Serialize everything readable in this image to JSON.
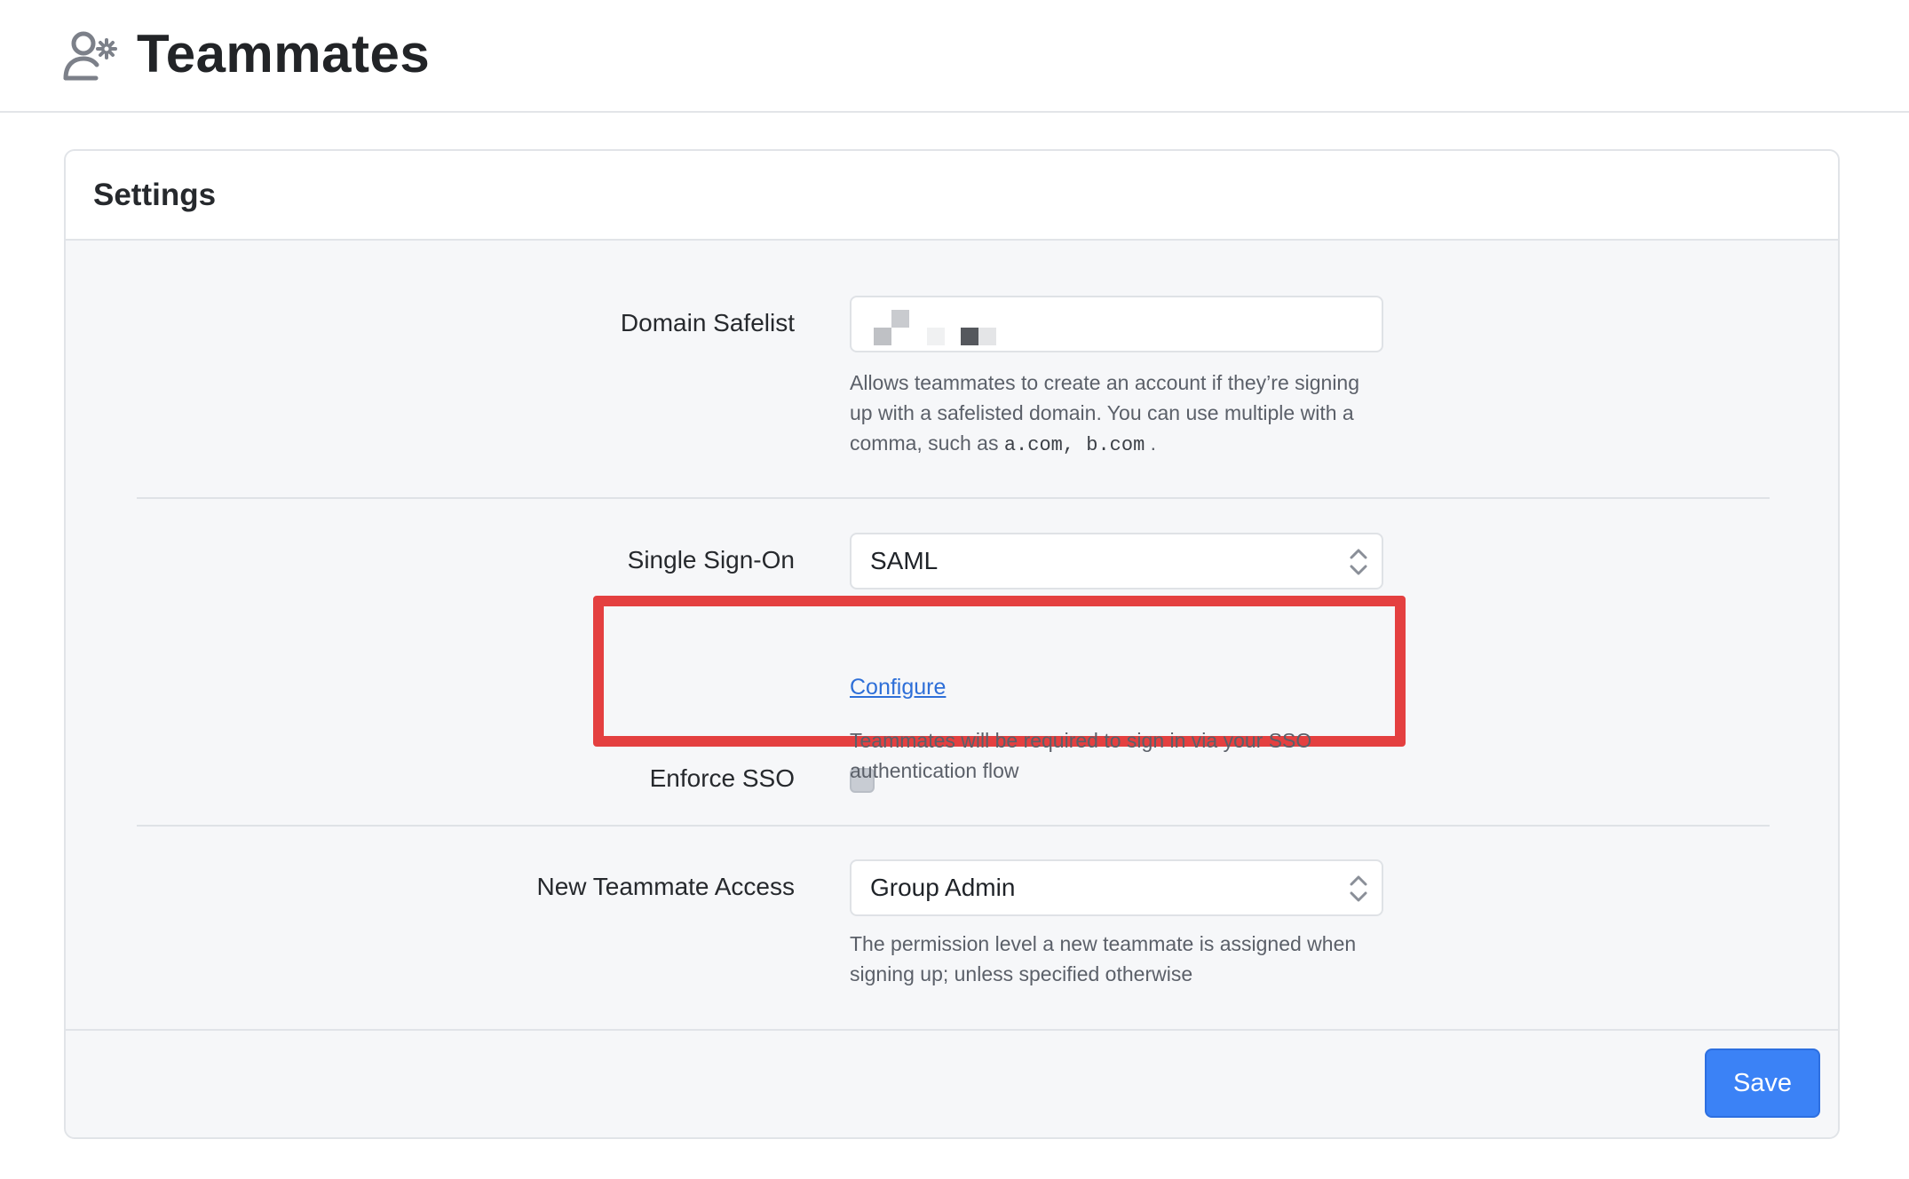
{
  "header": {
    "title": "Teammates",
    "icon": "user-gear-icon"
  },
  "settings": {
    "title": "Settings",
    "domain_safelist": {
      "label": "Domain Safelist",
      "help_prefix": "Allows teammates to create an account if they’re signing up with a safelisted domain. You can use multiple with a comma, such as ",
      "help_code": "a.com, b.com",
      "help_suffix": " ."
    },
    "single_sign_on": {
      "label": "Single Sign-On",
      "selected": "SAML",
      "configure_link": "Configure"
    },
    "enforce_sso": {
      "label": "Enforce SSO",
      "checked": false,
      "help": "Teammates will be required to sign in via your SSO authentication flow"
    },
    "new_teammate_access": {
      "label": "New Teammate Access",
      "selected": "Group Admin",
      "help": "The permission level a new teammate is assigned when signing up; unless specified otherwise"
    },
    "save_label": "Save"
  },
  "colors": {
    "accent": "#3b82f6",
    "highlight": "#e44040",
    "link": "#2e6fd8"
  }
}
